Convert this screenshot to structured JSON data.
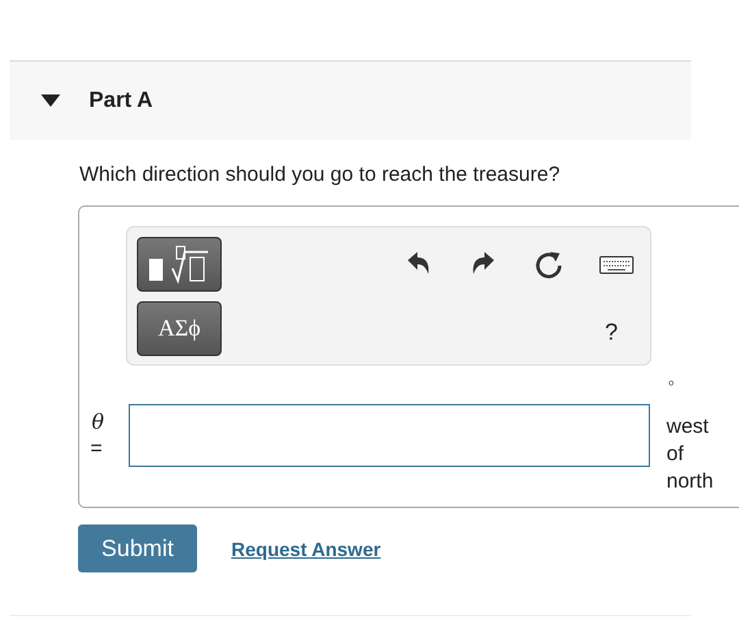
{
  "part": {
    "title": "Part A",
    "expanded": true
  },
  "question": "Which direction should you go to reach the treasure?",
  "toolbar": {
    "greek_button": {
      "label": "ΑΣϕ"
    },
    "help": "?"
  },
  "answer": {
    "variable": "θ",
    "equals": "=",
    "unit_mark": "∘",
    "unit": "west of north"
  },
  "buttons": {
    "submit": "Submit",
    "request": "Request Answer"
  }
}
